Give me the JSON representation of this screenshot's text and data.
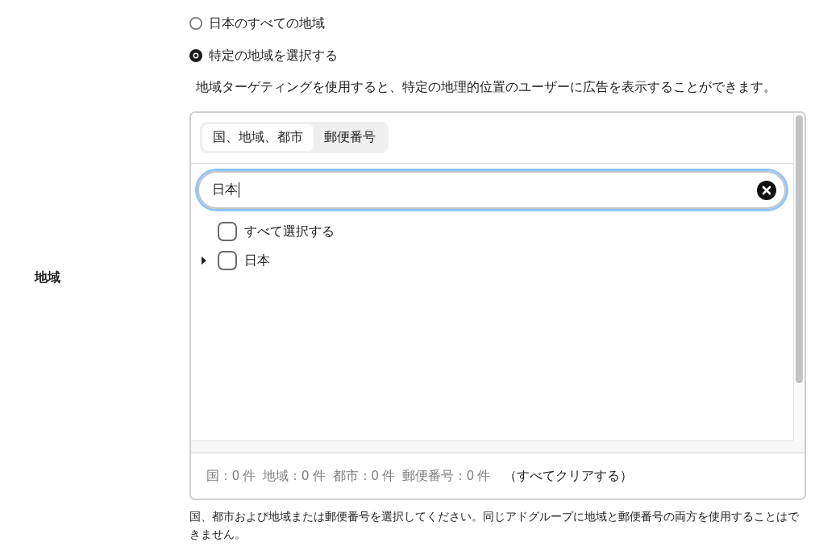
{
  "field_label": "地域",
  "radio_options": [
    {
      "label": "日本のすべての地域",
      "selected": false
    },
    {
      "label": "特定の地域を選択する",
      "selected": true
    }
  ],
  "description": "地域ターゲティングを使用すると、特定の地理的位置のユーザーに広告を表示することができます。",
  "location_picker": {
    "tabs": [
      {
        "label": "国、地域、都市",
        "selected": true
      },
      {
        "label": "郵便番号",
        "selected": false
      }
    ],
    "search": {
      "value": "日本"
    },
    "items": [
      {
        "kind": "select-all",
        "label": "すべて選択する",
        "checked": false
      },
      {
        "kind": "location",
        "label": "日本",
        "checked": false,
        "expanded": false
      }
    ],
    "counts": [
      "国：0 件",
      "地域：0 件",
      "都市：0 件",
      "郵便番号：0 件"
    ],
    "clear_all": "（すべてクリアする）"
  },
  "help_text": "国、都市および地域または郵便番号を選択してください。同じアドグループに地域と郵便番号の両方を使用することはできません。"
}
